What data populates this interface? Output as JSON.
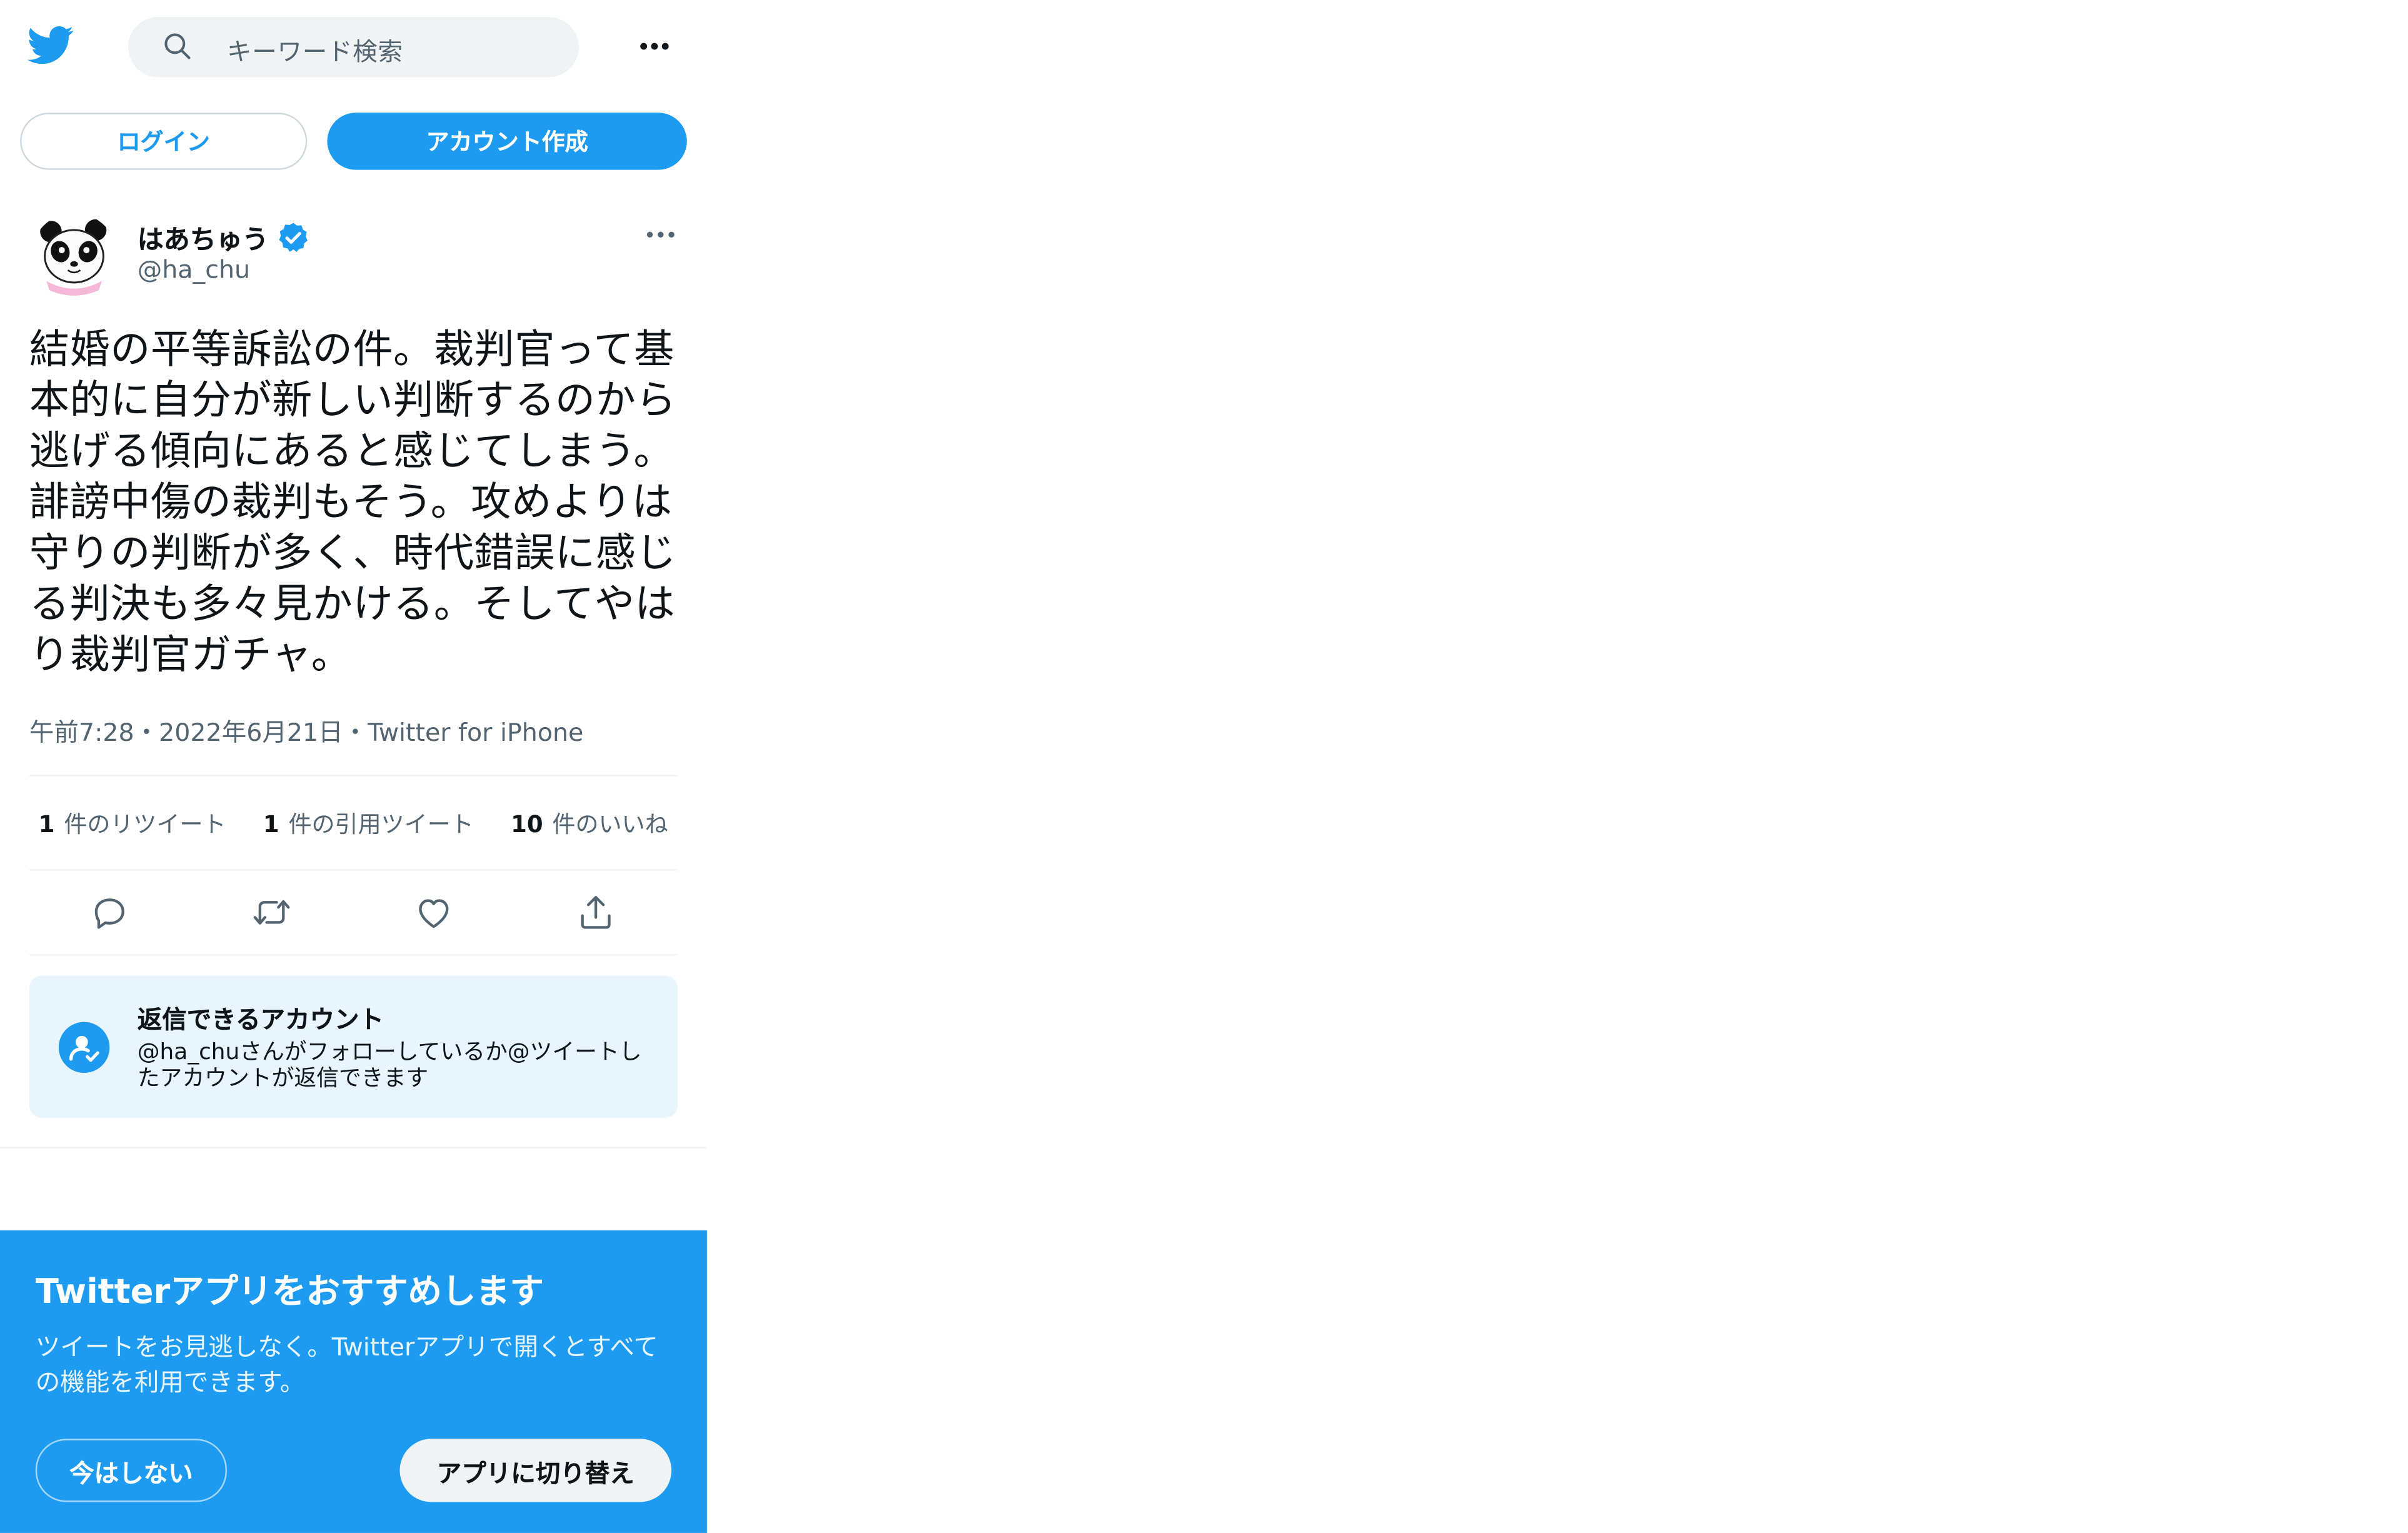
{
  "header": {
    "search_placeholder": "キーワード検索"
  },
  "auth": {
    "login_label": "ログイン",
    "signup_label": "アカウント作成"
  },
  "tweet": {
    "author_name": "はあちゅう",
    "author_handle": "@ha_chu",
    "text": "結婚の平等訴訟の件。裁判官って基本的に自分が新しい判断するのから逃げる傾向にあると感じてしまう。誹謗中傷の裁判もそう。攻めよりは守りの判断が多く、時代錯誤に感じる判決も多々見かける。そしてやはり裁判官ガチャ。",
    "meta": "午前7:28・2022年6月21日・Twitter for iPhone",
    "stats": {
      "retweets_count": "1",
      "retweets_label": "件のリツイート",
      "quotes_count": "1",
      "quotes_label": "件の引用ツイート",
      "likes_count": "10",
      "likes_label": "件のいいね"
    }
  },
  "reply_restriction": {
    "title": "返信できるアカウント",
    "body": "@ha_chuさんがフォローしているか@ツイートしたアカウントが返信できます"
  },
  "promo": {
    "title": "Twitterアプリをおすすめします",
    "text": "ツイートをお見逃しなく。Twitterアプリで開くとすべての機能を利用できます。",
    "not_now_label": "今はしない",
    "switch_label": "アプリに切り替え"
  },
  "colors": {
    "brand": "#1d9bf0",
    "text": "#0f1419",
    "secondary": "#536471",
    "reply_box_bg": "#e8f5fd"
  },
  "icons": [
    "twitter-bird-icon",
    "search-icon",
    "more-icon",
    "verified-icon",
    "reply-icon",
    "retweet-icon",
    "like-icon",
    "share-icon",
    "reply-permission-icon"
  ]
}
